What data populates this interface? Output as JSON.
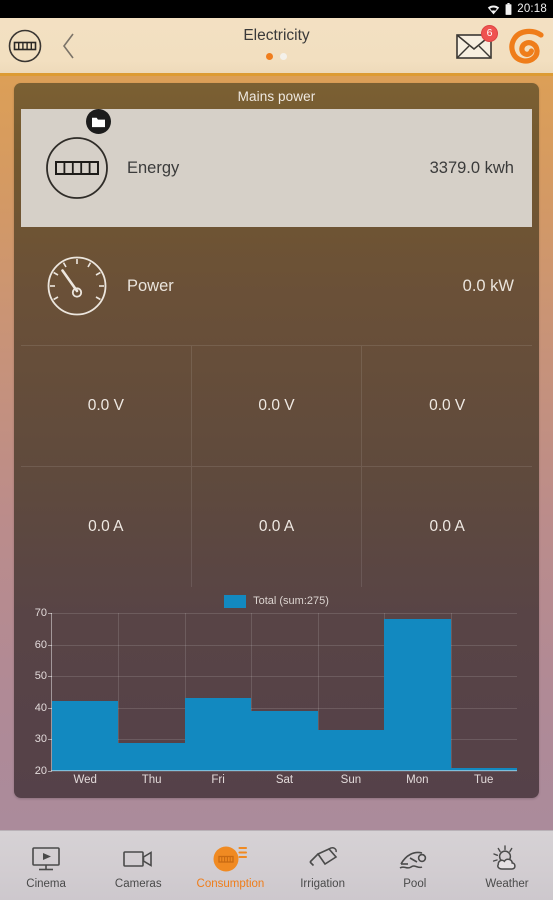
{
  "status_bar": {
    "time": "20:18",
    "icons": [
      "wifi-icon",
      "battery-icon"
    ]
  },
  "app_bar": {
    "meter_button_icon": "electricity-meter-icon",
    "back_icon": "chevron-left-icon",
    "title": "Electricity",
    "page_dots": {
      "count": 2,
      "active_index": 0,
      "active_color": "#f07d1c",
      "inactive_color": "#f4f1ea"
    },
    "mail_icon": "mail-icon",
    "mail_badge": "6",
    "logo_icon": "fibaro-logo-icon",
    "accent_color": "#dd9b33"
  },
  "card": {
    "title": "Mains power",
    "rows": [
      {
        "name": "energy",
        "icon": "electricity-meter-icon",
        "badge_icon": "folder-icon",
        "label": "Energy",
        "value": "3379.0 kwh"
      },
      {
        "name": "power",
        "icon": "gauge-icon",
        "label": "Power",
        "value": "0.0 kW"
      }
    ],
    "measurement_grid": [
      [
        "0.0 V",
        "0.0 V",
        "0.0 V"
      ],
      [
        "0.0 A",
        "0.0 A",
        "0.0 A"
      ]
    ]
  },
  "chart_data": {
    "type": "bar",
    "title": "",
    "subtitle": "",
    "xlabel": "",
    "ylabel": "",
    "categories": [
      "Wed",
      "Thu",
      "Fri",
      "Sat",
      "Sun",
      "Mon",
      "Tue"
    ],
    "values": [
      42,
      29,
      43,
      39,
      33,
      68,
      21
    ],
    "series": [
      {
        "name": "Total (sum:275)",
        "values": [
          42,
          29,
          43,
          39,
          33,
          68,
          21
        ],
        "color": "#1289c0"
      }
    ],
    "legend": [
      {
        "label": "Total (sum:275)",
        "color": "#1289c0"
      }
    ],
    "legend_position": "top-center",
    "ylim": [
      20,
      70
    ],
    "yticks": [
      20,
      30,
      40,
      50,
      60,
      70
    ],
    "ytick_labels": [
      "20",
      "30",
      "40",
      "50",
      "60",
      "70"
    ],
    "grid": true,
    "bar_color": "#1289c0"
  },
  "bottom_nav": {
    "active_index": 2,
    "items": [
      {
        "label": "Cinema",
        "icon": "tv-play-icon"
      },
      {
        "label": "Cameras",
        "icon": "video-camera-icon"
      },
      {
        "label": "Consumption",
        "icon": "electricity-meter-icon"
      },
      {
        "label": "Irrigation",
        "icon": "watering-can-icon"
      },
      {
        "label": "Pool",
        "icon": "swimmer-icon"
      },
      {
        "label": "Weather",
        "icon": "sun-cloud-icon"
      }
    ]
  }
}
